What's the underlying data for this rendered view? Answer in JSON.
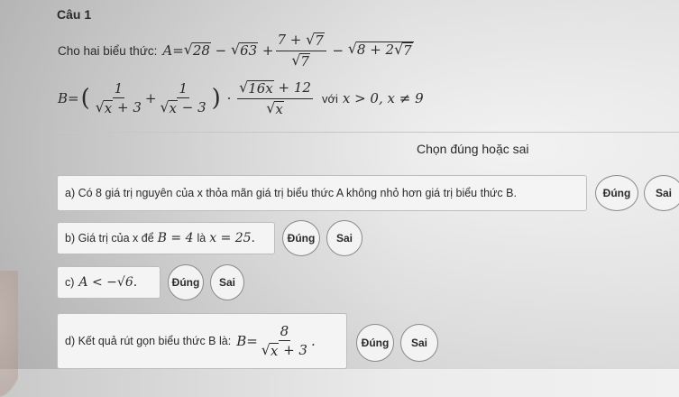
{
  "question": {
    "title": "Câu 1",
    "intro": "Cho hai biểu thức:",
    "condition_text": "với",
    "condition_math": "x > 0, x ≠ 9",
    "instruction": "Chọn đúng hoặc sai"
  },
  "options": [
    {
      "id": "a",
      "text": "a) Có 8 giá trị nguyên của x thỏa mãn giá trị biểu thức A không nhỏ hơn giá trị biểu thức B.",
      "true_label": "Đúng",
      "false_label": "Sai"
    },
    {
      "id": "b",
      "text": "b) Giá trị của x để",
      "math_1": "B = 4",
      "mid": "là",
      "math_2": "x = 25.",
      "true_label": "Đúng",
      "false_label": "Sai"
    },
    {
      "id": "c",
      "text": "c)",
      "math": "A < −√6.",
      "true_label": "Đúng",
      "false_label": "Sai"
    },
    {
      "id": "d",
      "text": "d) Kết quả rút gọn biểu thức B là:",
      "true_label": "Đúng",
      "false_label": "Sai"
    }
  ]
}
